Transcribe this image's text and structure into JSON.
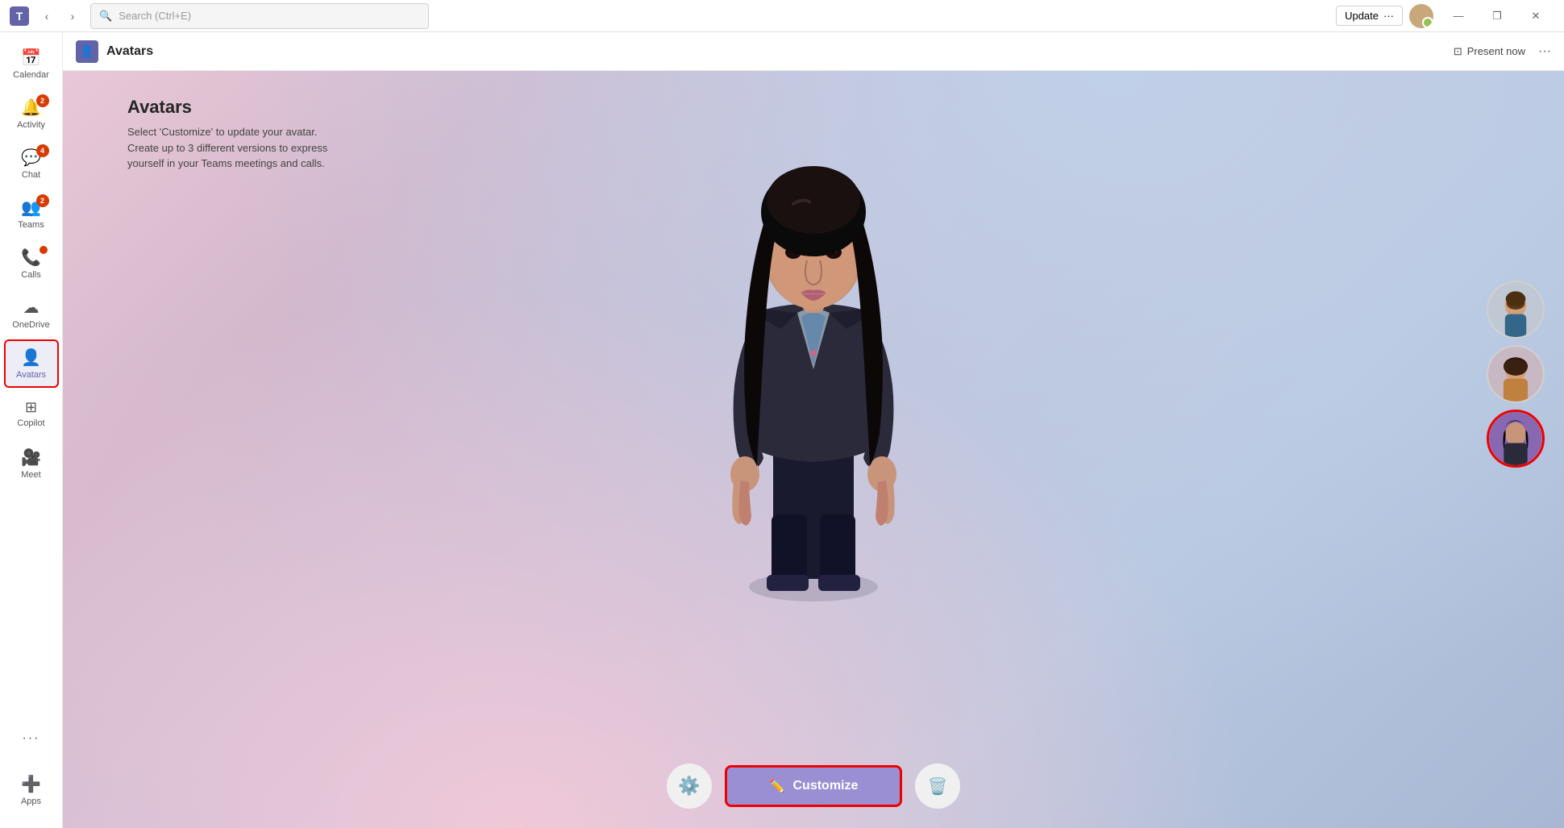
{
  "titlebar": {
    "app_name": "Microsoft Teams",
    "search_placeholder": "Search (Ctrl+E)",
    "update_label": "Update",
    "more_label": "···",
    "win_minimize": "—",
    "win_restore": "❐",
    "win_close": "✕"
  },
  "sidebar": {
    "items": [
      {
        "id": "calendar",
        "label": "Calendar",
        "icon": "📅",
        "badge": null,
        "active": false
      },
      {
        "id": "activity",
        "label": "Activity",
        "icon": "🔔",
        "badge": "2",
        "active": false
      },
      {
        "id": "chat",
        "label": "Chat",
        "icon": "💬",
        "badge": "4",
        "active": false
      },
      {
        "id": "teams",
        "label": "Teams",
        "icon": "👥",
        "badge": "2",
        "active": false
      },
      {
        "id": "calls",
        "label": "Calls",
        "icon": "📞",
        "badge_dot": true,
        "active": false
      },
      {
        "id": "onedrive",
        "label": "OneDrive",
        "icon": "☁",
        "active": false
      },
      {
        "id": "avatars",
        "label": "Avatars",
        "icon": "👤",
        "active": true
      },
      {
        "id": "copilot",
        "label": "Copilot",
        "icon": "⊞",
        "active": false
      },
      {
        "id": "meet",
        "label": "Meet",
        "icon": "🎥",
        "active": false
      }
    ],
    "more_label": "···",
    "apps_label": "Apps"
  },
  "app_header": {
    "icon": "👤",
    "title": "Avatars",
    "present_now": "Present now",
    "more": "···"
  },
  "avatar_page": {
    "heading": "Avatars",
    "description_line1": "Select 'Customize' to update your avatar.",
    "description_line2": "Create up to 3 different versions to express",
    "description_line3": "yourself in your Teams meetings and calls.",
    "customize_label": "Customize",
    "settings_icon": "⚙",
    "delete_icon": "🗑",
    "pencil_icon": "✏"
  }
}
